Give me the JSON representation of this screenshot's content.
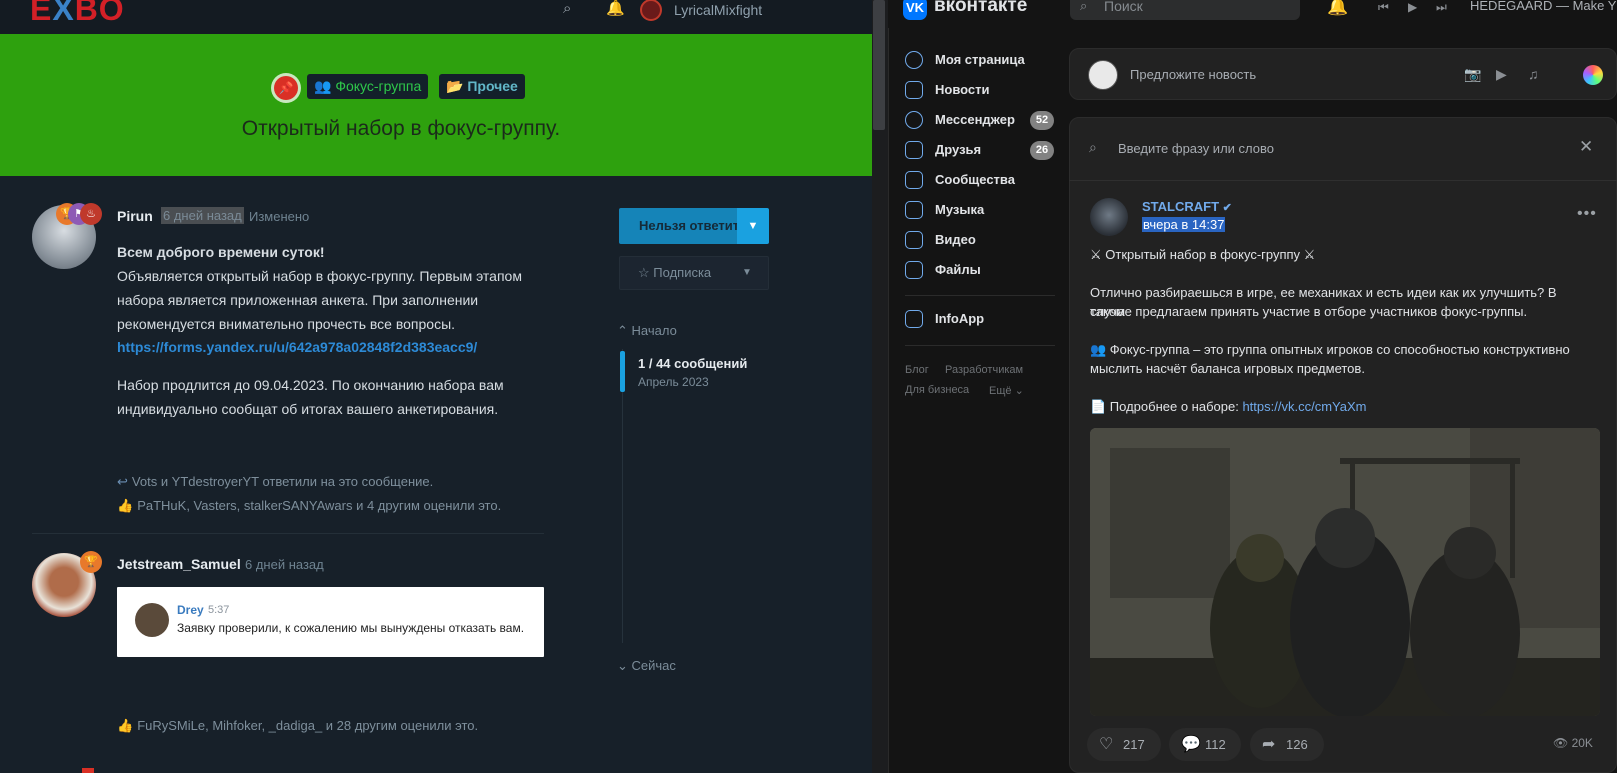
{
  "forum": {
    "logo_left": "E",
    "logo_mid": "X",
    "logo_right": "BO",
    "username": "LyricalMixfight",
    "tag_group": "Фокус-группа",
    "tag_other": "Прочее",
    "thread_title": "Открытый набор в фокус-группу.",
    "post1": {
      "author": "Pirun",
      "time": "6 дней назад",
      "edited": "Изменено",
      "greeting": "Всем доброго времени суток!",
      "line1": "Объявляется открытый набор в фокус-группу. Первым этапом",
      "line2": "набора является приложенная анкета. При заполнении",
      "line3": "рекомендуется внимательно прочесть все вопросы.",
      "link": "https://forms.yandex.ru/u/642a978a02848f2d383eacc9/",
      "line4": "Набор продлится до 09.04.2023. По окончанию набора вам",
      "line5": "индивидуально сообщат об итогах вашего анкетирования.",
      "replies": "Vots и YTdestroyerYT ответили на это сообщение.",
      "likes": "PaTHuK, Vasters, stalkerSANYAwars и 4 другим оценили это."
    },
    "post2": {
      "author": "Jetstream_Samuel",
      "time": "6 дней назад",
      "quote_name": "Drey",
      "quote_time": "5:37",
      "quote_text": "Заявку проверили, к сожалению мы вынуждены отказать вам.",
      "likes": "FuRySMiLe, Mihfoker, _dadiga_ и 28 другим оценили это."
    },
    "reply_button": "Нельзя ответить",
    "subscribe_button": "Подписка",
    "timeline_start": "Начало",
    "timeline_count": "1 / 44 сообщений",
    "timeline_date": "Апрель 2023",
    "timeline_now": "Сейчас"
  },
  "vk": {
    "logo": "VK",
    "brand": "вконтакте",
    "search_placeholder": "Поиск",
    "track": "HEDEGAARD — Make Y",
    "nav": {
      "my_page": "Моя страница",
      "news": "Новости",
      "messenger": "Мессенджер",
      "messenger_count": "52",
      "friends": "Друзья",
      "friends_count": "26",
      "communities": "Сообщества",
      "music": "Музыка",
      "video": "Видео",
      "files": "Файлы",
      "infoapp": "InfoApp"
    },
    "footer": {
      "blog": "Блог",
      "developers": "Разработчикам",
      "business": "Для бизнеса",
      "more": "Ещё"
    },
    "compose_placeholder": "Предложите новость",
    "feed_search_placeholder": "Введите фразу или слово",
    "post": {
      "author": "STALCRAFT",
      "time": "вчера в 14:37",
      "headline": "⚔ Открытый набор в фокус-группу ⚔",
      "p1a": "Отлично разбираешься в игре, ее механиках и есть идеи как их улучшить? В таком",
      "p1b": "случае предлагаем принять участие в отборе участников фокус-группы.",
      "p2a": "👥 Фокус-группа – это группа опытных игроков со способностью конструктивно",
      "p2b": "мыслить насчёт баланса игровых предметов.",
      "p3": "📄 Подробнее о наборе: ",
      "p3_link": "https://vk.cc/cmYaXm",
      "likes": "217",
      "comments": "112",
      "shares": "126",
      "views": "20K"
    }
  },
  "colors": {
    "banner_green": "#2ea10e",
    "forum_bg": "#172029",
    "vk_bg": "#141414",
    "vk_accent": "#71aaeb",
    "forum_accent": "#1aa1e0"
  }
}
